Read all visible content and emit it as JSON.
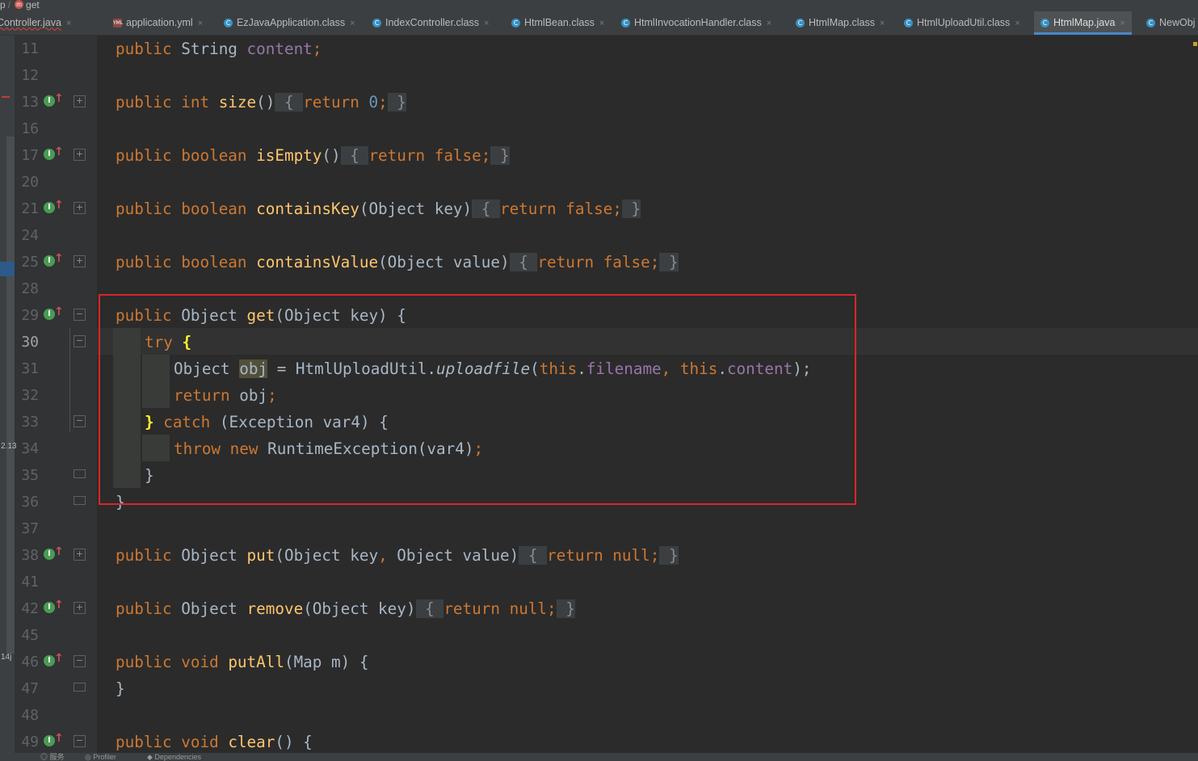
{
  "breadcrumb": {
    "prefix": "p",
    "sep": "/",
    "method_icon": "m",
    "method": "get"
  },
  "tabs": [
    {
      "label": "Controller.java",
      "icon": "c",
      "kind": "java",
      "active": false,
      "error": true
    },
    {
      "label": "application.yml",
      "icon": "YML",
      "kind": "yml",
      "active": false,
      "error": false
    },
    {
      "label": "EzJavaApplication.class",
      "icon": "C",
      "kind": "class",
      "active": false,
      "error": false
    },
    {
      "label": "IndexController.class",
      "icon": "C",
      "kind": "class",
      "active": false,
      "error": false
    },
    {
      "label": "HtmlBean.class",
      "icon": "C",
      "kind": "class",
      "active": false,
      "error": false
    },
    {
      "label": "HtmlInvocationHandler.class",
      "icon": "C",
      "kind": "class",
      "active": false,
      "error": false
    },
    {
      "label": "HtmlMap.class",
      "icon": "C",
      "kind": "class",
      "active": false,
      "error": false
    },
    {
      "label": "HtmlUploadUtil.class",
      "icon": "C",
      "kind": "class",
      "active": false,
      "error": false
    },
    {
      "label": "HtmlMap.java",
      "icon": "C",
      "kind": "java",
      "active": true,
      "error": false
    },
    {
      "label": "NewObj",
      "icon": "C",
      "kind": "class",
      "active": false,
      "error": false
    }
  ],
  "tab_close_glyph": "×",
  "gutter_side_labels": [
    "2.13",
    "14j"
  ],
  "line_numbers": [
    "11",
    "12",
    "13",
    "16",
    "17",
    "20",
    "21",
    "24",
    "25",
    "28",
    "29",
    "30",
    "31",
    "32",
    "33",
    "34",
    "35",
    "36",
    "37",
    "38",
    "41",
    "42",
    "45",
    "46",
    "47",
    "48",
    "49"
  ],
  "current_line": "30",
  "code": {
    "l11": {
      "kw": "public",
      "type": "String",
      "field": "content",
      "semi": ";"
    },
    "l13": {
      "kw": "public",
      "type": "int",
      "name": "size",
      "params": "()",
      "open": "{",
      "ret": "return",
      "val": "0",
      "semi": ";",
      "close": "}"
    },
    "l17": {
      "kw": "public",
      "type": "boolean",
      "name": "isEmpty",
      "params": "()",
      "open": "{",
      "ret": "return",
      "val": "false",
      "semi": ";",
      "close": "}"
    },
    "l21": {
      "kw": "public",
      "type": "boolean",
      "name": "containsKey",
      "params": "(Object key)",
      "open": "{",
      "ret": "return",
      "val": "false",
      "semi": ";",
      "close": "}"
    },
    "l25": {
      "kw": "public",
      "type": "boolean",
      "name": "containsValue",
      "params": "(Object value)",
      "open": "{",
      "ret": "return",
      "val": "false",
      "semi": ";",
      "close": "}"
    },
    "l29": {
      "kw": "public",
      "type": "Object",
      "name": "get",
      "params": "(Object key) {"
    },
    "l30": {
      "kw": "try",
      "open": "{"
    },
    "l31": {
      "type": "Object",
      "var": "obj",
      "eq": " = HtmlUploadUtil.",
      "call": "uploadfile",
      "paren": "(",
      "this1": "this",
      "dot1": ".",
      "f1": "filename",
      "comma": ", ",
      "this2": "this",
      "dot2": ".",
      "f2": "content",
      "end": ");"
    },
    "l32": {
      "kw": "return",
      "rest": "obj",
      "semi": ";"
    },
    "l33": {
      "close": "}",
      "kw": "catch",
      "rest": " (Exception var4) {"
    },
    "l34": {
      "kw1": "throw",
      "kw2": "new",
      "rest": " RuntimeException(var4)",
      "semi": ";"
    },
    "l35": {
      "close": "}"
    },
    "l36": {
      "close": "}"
    },
    "l38": {
      "kw": "public",
      "type": "Object",
      "name": "put",
      "params": "(Object key",
      "comma": ",",
      "params2": " Object value)",
      "open": "{",
      "ret": "return",
      "val": "null",
      "semi": ";",
      "close": "}"
    },
    "l42": {
      "kw": "public",
      "type": "Object",
      "name": "remove",
      "params": "(Object key)",
      "open": "{",
      "ret": "return",
      "val": "null",
      "semi": ";",
      "close": "}"
    },
    "l46": {
      "kw": "public",
      "type": "void",
      "name": "putAll",
      "params": "(Map m) {"
    },
    "l47": {
      "close": "}"
    },
    "l49": {
      "kw": "public",
      "type": "void",
      "name": "clear",
      "params": "() {"
    }
  },
  "status_items": [
    "◎ 服务",
    "◎ Profiler",
    "◆ Dependencies"
  ],
  "colors": {
    "keyword": "#cc7832",
    "method": "#ffc66d",
    "number": "#6897bb",
    "field": "#9876aa",
    "text": "#a9b7c6",
    "annotation_box": "#d8262b"
  }
}
